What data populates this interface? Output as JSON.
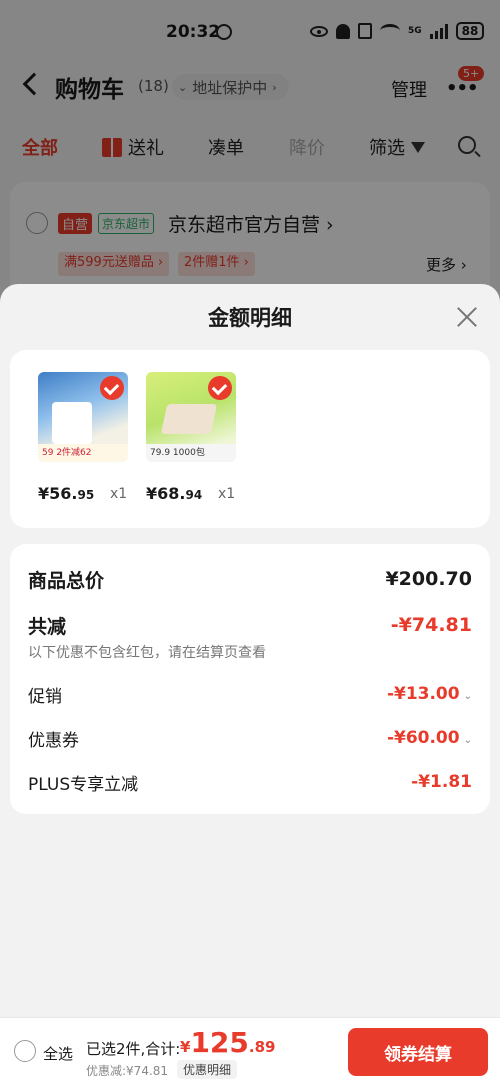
{
  "status_bar": {
    "time": "20:32",
    "network": "5G",
    "battery": "88"
  },
  "header": {
    "title": "购物车",
    "count": "(18)",
    "address": "地址保护中",
    "manage": "管理",
    "badge": "5+"
  },
  "tabs": [
    {
      "label": "全部",
      "state": "active"
    },
    {
      "label": "送礼",
      "state": "normal"
    },
    {
      "label": "凑单",
      "state": "normal"
    },
    {
      "label": "降价",
      "state": "disabled"
    },
    {
      "label": "筛选",
      "state": "normal"
    }
  ],
  "store": {
    "tag_self": "自营",
    "tag_market": "京东超市",
    "name": "京东超市官方自营",
    "promo1": "满599元送赠品 ›",
    "promo2": "2件赠1件 ›",
    "more": "更多 ›"
  },
  "sheet": {
    "title": "金额明细",
    "items": [
      {
        "price_int": "¥56.",
        "price_dec": "95",
        "qty": "x1",
        "thumb_text": "2件减62",
        "thumb_price": "59"
      },
      {
        "price_int": "¥68.",
        "price_dec": "94",
        "qty": "x1",
        "thumb_text": "1000包",
        "thumb_price": "79.9"
      }
    ],
    "rows": {
      "total_label": "商品总价",
      "total_value": "¥200.70",
      "reduce_label": "共减",
      "reduce_value": "-¥74.81",
      "note": "以下优惠不包含红包，请在结算页查看",
      "promo_label": "促销",
      "promo_value": "-¥13.00",
      "coupon_label": "优惠券",
      "coupon_value": "-¥60.00",
      "plus_label": "PLUS专享立减",
      "plus_value": "-¥1.81"
    }
  },
  "bottom": {
    "select_all": "全选",
    "selected": "已选2件,合计:",
    "price_sym": "¥",
    "price_int": "125",
    "price_dec": ".89",
    "discount": "优惠减:¥74.81",
    "detail_btn": "优惠明细",
    "checkout": "领券结算"
  },
  "colors": {
    "accent": "#e93b2b",
    "green": "#2fb36a"
  }
}
